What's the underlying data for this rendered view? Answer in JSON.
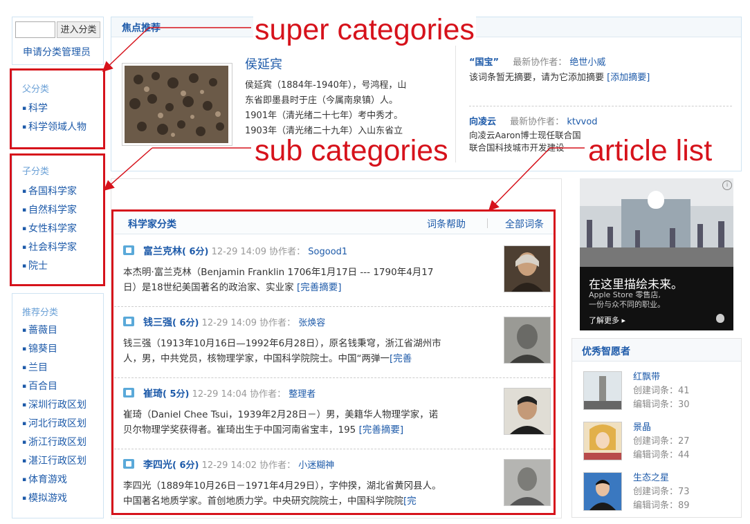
{
  "search": {
    "button_label": "进入分类"
  },
  "apply_admin": "申请分类管理员",
  "parent_categories": {
    "title": "父分类",
    "items": [
      "科学",
      "科学领域人物"
    ]
  },
  "sub_categories": {
    "title": "子分类",
    "items": [
      "各国科学家",
      "自然科学家",
      "女性科学家",
      "社会科学家",
      "院士"
    ]
  },
  "recommended_categories": {
    "title": "推荐分类",
    "items": [
      "蔷薇目",
      "锦葵目",
      "兰目",
      "百合目",
      "深圳行政区划",
      "河北行政区划",
      "浙江行政区划",
      "湛江行政区划",
      "体育游戏",
      "模拟游戏"
    ]
  },
  "featured": {
    "title": "焦点推荐",
    "main": {
      "name": "侯延宾",
      "summary_lines": [
        "侯延宾（1884年-1940年），号鸿程，山",
        "东省即墨县时于庄（今属南泉镇）人。",
        "1901年（清光绪二十七年）考中秀才。",
        "1903年（清光绪二十九年）入山东省立"
      ]
    },
    "side_items": [
      {
        "name": "“国宝”",
        "collab_label": "最新协作者：",
        "collaborator": "绝世小威",
        "summary": "该词条暂无摘要，请为它添加摘要",
        "link": "[添加摘要]"
      },
      {
        "name": "向凌云",
        "collab_label": "最新协作者：",
        "collaborator": "ktvvod",
        "summary_lines": [
          "向凌云Aaron博士现任联合国",
          "联合国科技城市开发建设"
        ]
      }
    ]
  },
  "article_list": {
    "title": "科学家分类",
    "help_link": "词条帮助",
    "all_link": "全部词条",
    "collab_label": "协作者：",
    "items": [
      {
        "name": "富兰克林",
        "score": "( 6分)",
        "date": "12-29 14:09",
        "collaborator": "Sogood1",
        "line1": "本杰明·富兰克林（Benjamin Franklin 1706年1月17日 --- 1790年4月17",
        "line2": "日）是18世纪美国著名的政治家、实业家",
        "more": "[完善摘要]"
      },
      {
        "name": "钱三强",
        "score": "( 6分)",
        "date": "12-29 14:09",
        "collaborator": "张焕容",
        "line1": "钱三强（1913年10月16日—1992年6月28日），原名钱秉穹，浙江省湖州市",
        "line2": "人，男，中共党员，核物理学家，中国科学院院士。中国“两弹一",
        "more": "[完善"
      },
      {
        "name": "崔琦",
        "score": "( 5分)",
        "date": "12-29 14:04",
        "collaborator": "整理者",
        "line1": "崔琦（Daniel Chee Tsui，1939年2月28日－）男，美籍华人物理学家，诺",
        "line2": "贝尔物理学奖获得者。崔琦出生于中国河南省宝丰，195",
        "more": "[完善摘要]"
      },
      {
        "name": "李四光",
        "score": "( 6分)",
        "date": "12-29 14:02",
        "collaborator": "小迷糊神",
        "line1": "李四光（1889年10月26日－1971年4月29日），字仲揆，湖北省黄冈县人。",
        "line2": "中国著名地质学家。首创地质力学。中央研究院院士，中国科学院院",
        "more": "[完"
      }
    ]
  },
  "ad": {
    "brand": "Apple Store",
    "headline": "在这里描绘未来。",
    "sub1": "Apple Store 零售店,",
    "sub2": "一份与众不同的职业。",
    "more": "了解更多 ▸"
  },
  "volunteers": {
    "title": "优秀智愿者",
    "created_label": "创建词条：",
    "edited_label": "编辑词条：",
    "items": [
      {
        "name": "红飘带",
        "created": "41",
        "edited": "30"
      },
      {
        "name": "景晶",
        "created": "27",
        "edited": "44"
      },
      {
        "name": "生态之星",
        "created": "73",
        "edited": "89"
      }
    ]
  },
  "annotations": {
    "super": "super categories",
    "sub": "sub categories",
    "articles": "article list"
  },
  "colors": {
    "link": "#1d5aa9",
    "annotation_red": "#d6121b",
    "panel_border": "#cfe3f2"
  }
}
